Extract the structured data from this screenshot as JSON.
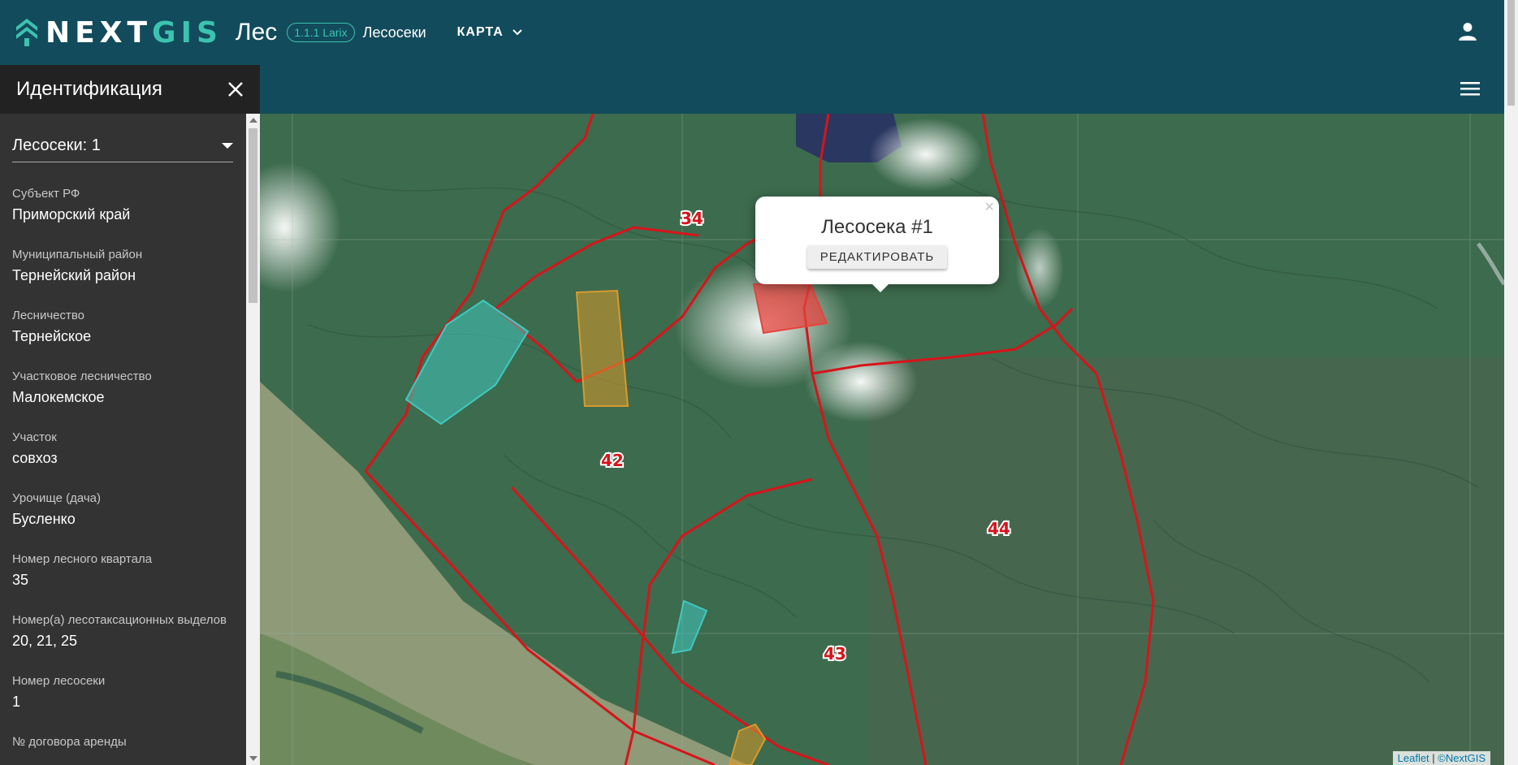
{
  "header": {
    "logo_text_next": "NEXT",
    "logo_text_gis": "GIS",
    "app_name": "Лес",
    "version": "1.1.1 Larix",
    "section": "Лесосеки",
    "menu_label": "КАРТА",
    "brand_color": "#3cc3b0",
    "header_color": "#124b5c"
  },
  "sidebar": {
    "title": "Идентификация",
    "select_value": "Лесосеки: 1",
    "fields": [
      {
        "label": "Субъект РФ",
        "value": "Приморский край"
      },
      {
        "label": "Муниципальный район",
        "value": "Тернейский район"
      },
      {
        "label": "Лесничество",
        "value": "Тернейское"
      },
      {
        "label": "Участковое лесничество",
        "value": "Малокемское"
      },
      {
        "label": "Участок",
        "value": "совхоз"
      },
      {
        "label": "Урочище (дача)",
        "value": "Бусленко"
      },
      {
        "label": "Номер лесного квартала",
        "value": "35"
      },
      {
        "label": "Номер(а) лесотаксационных выделов",
        "value": "20, 21, 25"
      },
      {
        "label": "Номер лесосеки",
        "value": "1"
      },
      {
        "label": "№ договора аренды",
        "value": ""
      }
    ]
  },
  "map": {
    "quarter_labels": [
      "34",
      "42",
      "44",
      "43"
    ],
    "popup": {
      "title": "Лесосека #1",
      "button": "РЕДАКТИРОВАТЬ",
      "close": "×"
    },
    "attribution": {
      "leaflet": "Leaflet",
      "sep": " | ",
      "nextgis": "©NextGIS"
    },
    "colors": {
      "boundary": "#d7141a",
      "plot_selected": "#e5443f",
      "plot_orange": "#d99a2b",
      "plot_cyan": "#3fc9c0"
    }
  }
}
